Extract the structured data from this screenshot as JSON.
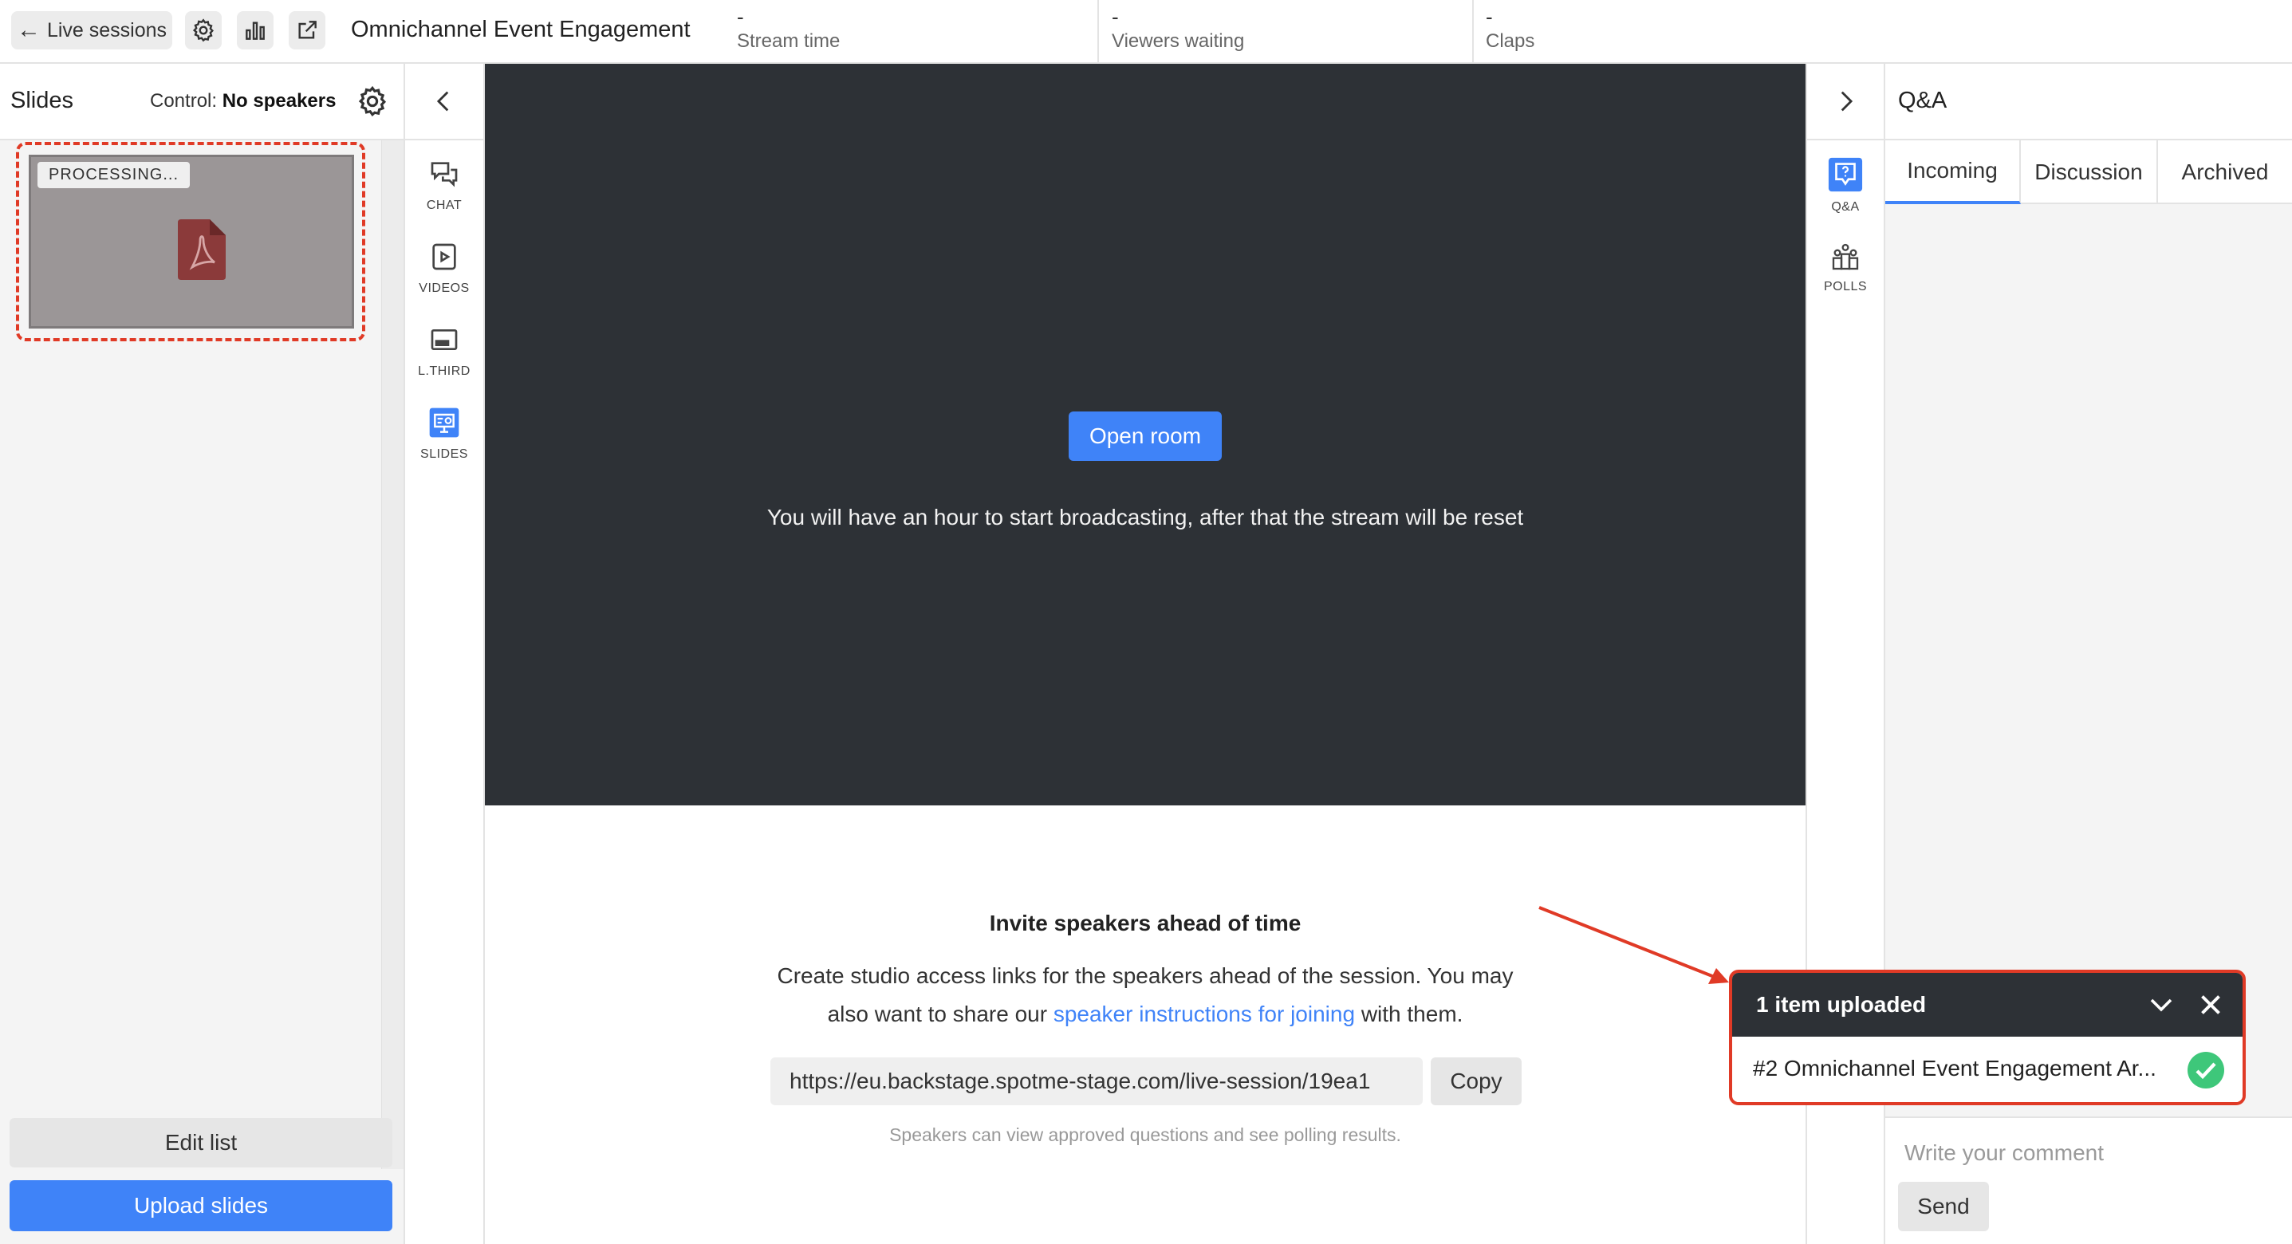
{
  "topbar": {
    "back_label": "Live sessions",
    "title": "Omnichannel Event Engagement",
    "metrics": [
      {
        "value": "-",
        "label": "Stream time"
      },
      {
        "value": "-",
        "label": "Viewers waiting"
      },
      {
        "value": "-",
        "label": "Claps"
      }
    ]
  },
  "slides_panel": {
    "title": "Slides",
    "control_label": "Control:",
    "control_value": "No speakers",
    "processing_badge": "PROCESSING...",
    "edit_list": "Edit list",
    "upload_slides": "Upload slides"
  },
  "tools": {
    "chat": "CHAT",
    "videos": "VIDEOS",
    "lthird": "L.THIRD",
    "slides": "SLIDES"
  },
  "stage": {
    "open_room": "Open room",
    "message": "You will have an hour to start broadcasting, after that the stream will be reset"
  },
  "invite": {
    "title": "Invite speakers ahead of time",
    "text_before": "Create studio access links for the speakers ahead of the session. You may also want to share our ",
    "link": "speaker instructions for joining",
    "text_after": " with them.",
    "url": "https://eu.backstage.spotme-stage.com/live-session/19ea1",
    "copy": "Copy",
    "note": "Speakers can view approved questions and see polling results."
  },
  "right_tools": {
    "qa": "Q&A",
    "polls": "POLLS"
  },
  "qa_panel": {
    "title": "Q&A",
    "tabs": [
      "Incoming",
      "Discussion",
      "Archived"
    ],
    "comment_placeholder": "Write your comment",
    "send": "Send"
  },
  "upload_toast": {
    "title": "1 item uploaded",
    "file": "#2 Omnichannel Event Engagement Ar..."
  },
  "colors": {
    "accent": "#3f83f8",
    "stage_bg": "#2d3136",
    "annotation": "#e03a26",
    "success": "#3ec77a",
    "pdf_icon": "#8b3a3a"
  }
}
